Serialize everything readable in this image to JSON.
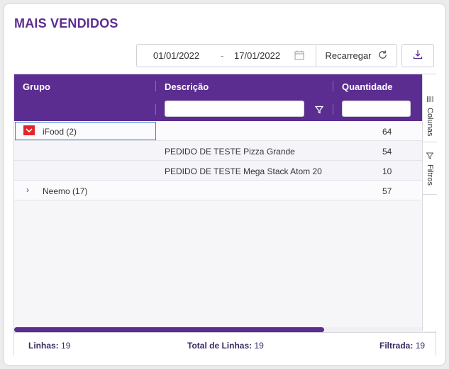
{
  "page": {
    "title": "MAIS VENDIDOS"
  },
  "dates": {
    "start": "01/01/2022",
    "separator": "-",
    "end": "17/01/2022"
  },
  "toolbar": {
    "reload_label": "Recarregar"
  },
  "grid": {
    "columns": [
      "Grupo",
      "Descrição",
      "Quantidade"
    ],
    "rows": [
      {
        "group": "iFood (2)",
        "description": "",
        "quantity": "64",
        "expanded": true
      },
      {
        "group": "",
        "description": "PEDIDO DE TESTE Pizza Grande",
        "quantity": "54"
      },
      {
        "group": "",
        "description": "PEDIDO DE TESTE Mega Stack Atom 20",
        "quantity": "10"
      },
      {
        "group": "Neemo (17)",
        "description": "",
        "quantity": "57",
        "expanded": false
      }
    ]
  },
  "sidebar": {
    "columns_label": "Colunas",
    "filters_label": "Filtros"
  },
  "footer": {
    "lines_label": "Linhas:",
    "lines_value": "19",
    "total_label": "Total de Linhas:",
    "total_value": "19",
    "filtered_label": "Filtrada:",
    "filtered_value": "19"
  },
  "colors": {
    "accent": "#5c2d91",
    "expander": "#e0262b",
    "focus": "#3a87c9"
  },
  "scroll": {
    "horizontal_thumb_fraction": 0.76
  }
}
